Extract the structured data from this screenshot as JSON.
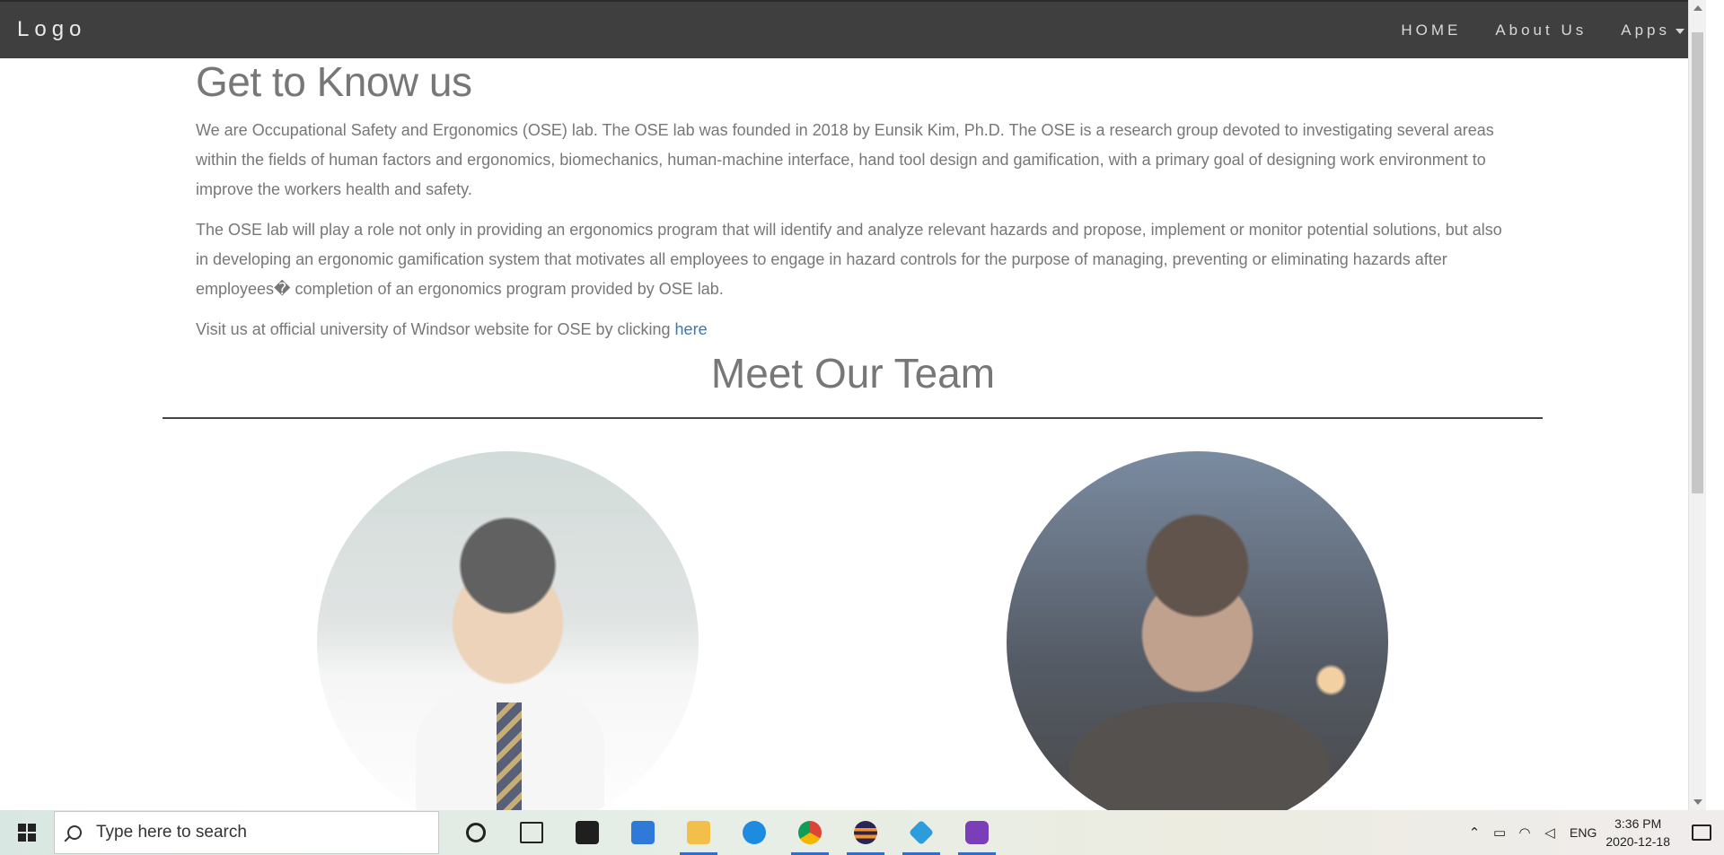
{
  "navbar": {
    "logo": "Logo",
    "links": [
      "HOME",
      "About Us",
      "Apps"
    ]
  },
  "about": {
    "title": "Get to Know us",
    "para1": "We are Occupational Safety and Ergonomics (OSE) lab. The OSE lab was founded in 2018 by Eunsik Kim, Ph.D. The OSE is a research group devoted to investigating several areas within the fields of human factors and ergonomics, biomechanics, human-machine interface, hand tool design and gamification, with a primary goal of designing work environment to improve the workers health and safety.",
    "para2": "The OSE lab will play a role not only in providing an ergonomics program that will identify and analyze relevant hazards and propose, implement or monitor potential solutions, but also in developing an ergonomic gamification system that motivates all employees to engage in hazard controls for the purpose of managing, preventing or eliminating hazards after employees� completion of an ergonomics program provided by OSE lab.",
    "para3_prefix": "Visit us at official university of Windsor website for OSE by clicking ",
    "para3_link": "here"
  },
  "team": {
    "title": "Meet Our Team"
  },
  "taskbar": {
    "search_placeholder": "Type here to search",
    "language": "ENG",
    "time": "3:36 PM",
    "date": "2020-12-18",
    "pinned_icons": [
      "cortana-icon",
      "task-view-icon",
      "store-icon",
      "mail-icon",
      "file-explorer-icon",
      "edge-icon",
      "chrome-icon",
      "eclipse-icon",
      "gitkraken-icon",
      "github-desktop-icon"
    ]
  }
}
